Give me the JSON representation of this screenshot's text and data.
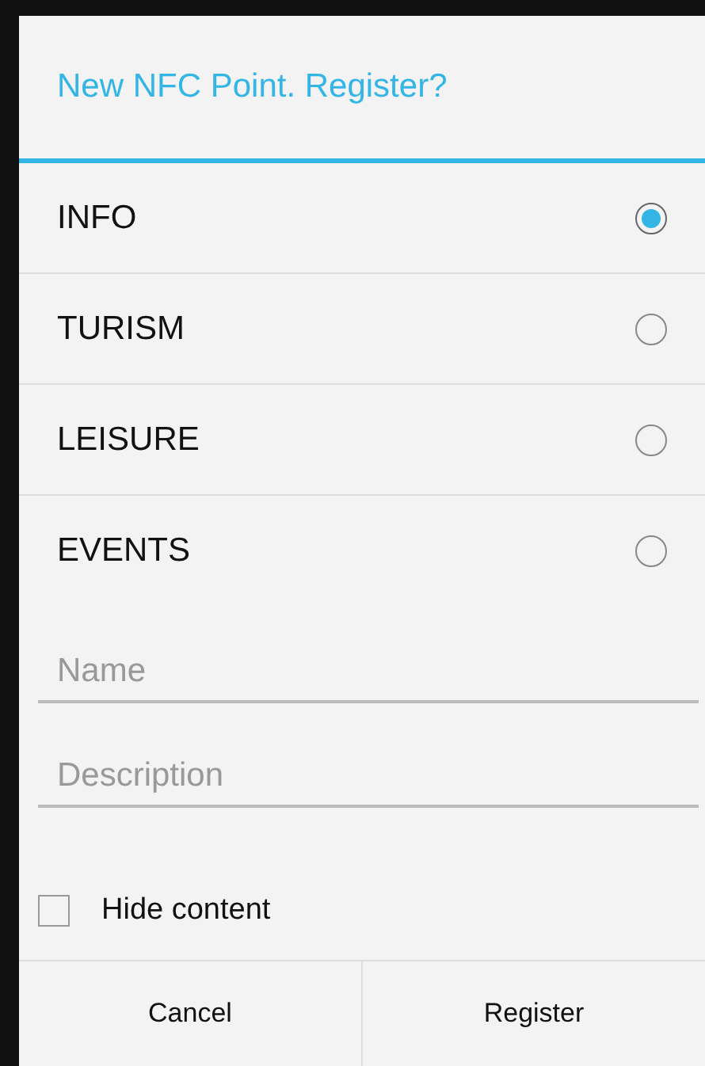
{
  "dialog": {
    "title": "New NFC Point. Register?",
    "options": [
      {
        "label": "INFO",
        "selected": true
      },
      {
        "label": "TURISM",
        "selected": false
      },
      {
        "label": "LEISURE",
        "selected": false
      },
      {
        "label": "EVENTS",
        "selected": false
      }
    ],
    "fields": [
      {
        "placeholder": "Name"
      },
      {
        "placeholder": "Description"
      }
    ],
    "checkbox": {
      "label": "Hide content",
      "checked": false
    },
    "buttons": [
      "Cancel",
      "Register"
    ]
  }
}
